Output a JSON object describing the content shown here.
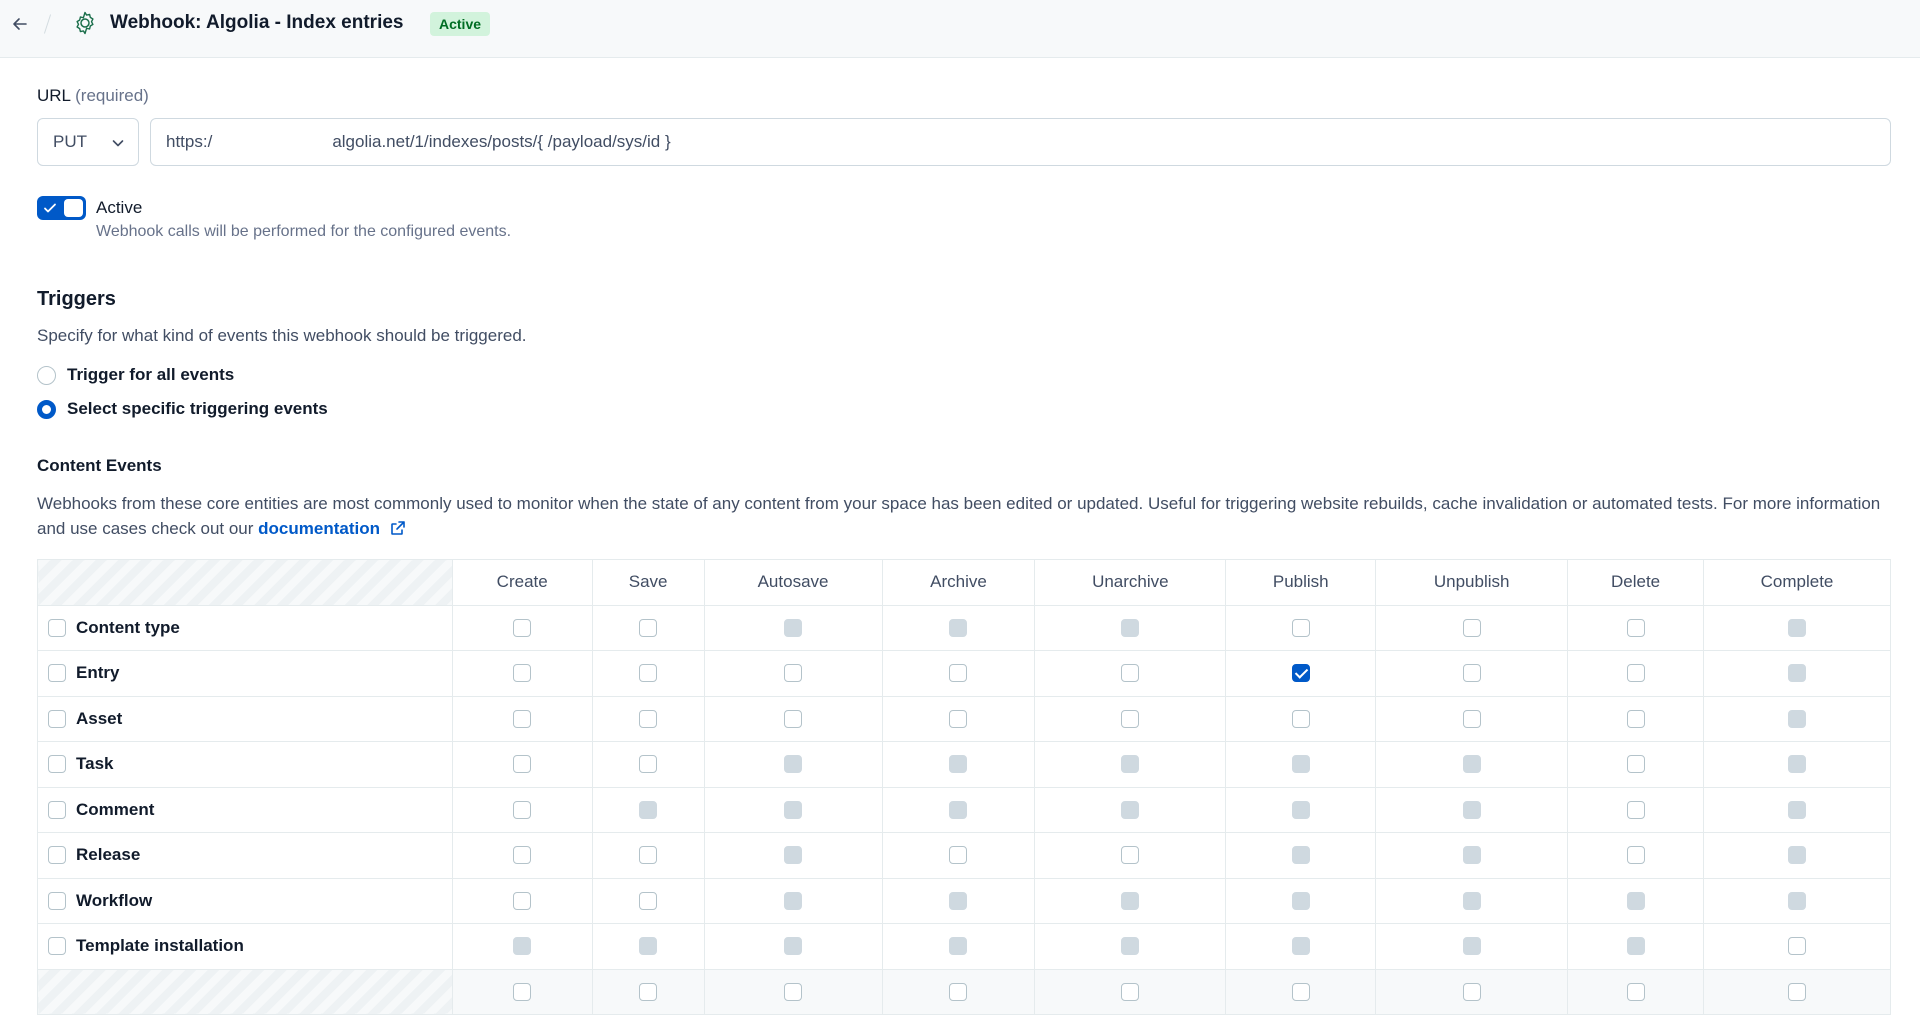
{
  "header": {
    "title": "Webhook: Algolia - Index entries",
    "status": "Active",
    "icons": {
      "back": "arrow-left-icon",
      "settings": "gear-icon"
    },
    "status_color": "#d2f3dc"
  },
  "url": {
    "label": "URL",
    "required_text": "(required)",
    "method": "PUT",
    "value_start": "https:/",
    "value_end": "algolia.net/1/indexes/posts/{ /payload/sys/id }"
  },
  "active": {
    "label": "Active",
    "help": "Webhook calls will be performed for the configured events.",
    "checked": true,
    "accent": "#0059c8"
  },
  "triggers": {
    "heading": "Triggers",
    "description": "Specify for what kind of events this webhook should be triggered.",
    "options": [
      {
        "label": "Trigger for all events",
        "checked": false
      },
      {
        "label": "Select specific triggering events",
        "checked": true
      }
    ]
  },
  "content_events": {
    "heading": "Content Events",
    "description": "Webhooks from these core entities are most commonly used to monitor when the state of any content from your space has been edited or updated. Useful for triggering website rebuilds, cache invalidation or automated tests. For more information and use cases check out our",
    "link_text": "documentation",
    "columns": [
      "Create",
      "Save",
      "Autosave",
      "Archive",
      "Unarchive",
      "Publish",
      "Unpublish",
      "Delete",
      "Complete"
    ],
    "rows": [
      {
        "label": "Content type",
        "cells": [
          "u",
          "u",
          "d",
          "d",
          "d",
          "u",
          "u",
          "u",
          "d"
        ]
      },
      {
        "label": "Entry",
        "cells": [
          "u",
          "u",
          "u",
          "u",
          "u",
          "c",
          "u",
          "u",
          "d"
        ]
      },
      {
        "label": "Asset",
        "cells": [
          "u",
          "u",
          "u",
          "u",
          "u",
          "u",
          "u",
          "u",
          "d"
        ]
      },
      {
        "label": "Task",
        "cells": [
          "u",
          "u",
          "d",
          "d",
          "d",
          "d",
          "d",
          "u",
          "d"
        ]
      },
      {
        "label": "Comment",
        "cells": [
          "u",
          "d",
          "d",
          "d",
          "d",
          "d",
          "d",
          "u",
          "d"
        ]
      },
      {
        "label": "Release",
        "cells": [
          "u",
          "u",
          "d",
          "u",
          "u",
          "d",
          "d",
          "u",
          "d"
        ]
      },
      {
        "label": "Workflow",
        "cells": [
          "u",
          "u",
          "d",
          "d",
          "d",
          "d",
          "d",
          "d",
          "d"
        ]
      },
      {
        "label": "Template installation",
        "cells": [
          "d",
          "d",
          "d",
          "d",
          "d",
          "d",
          "d",
          "d",
          "u"
        ]
      }
    ],
    "footer_cells": [
      "u",
      "u",
      "u",
      "u",
      "u",
      "u",
      "u",
      "u",
      "u"
    ]
  }
}
